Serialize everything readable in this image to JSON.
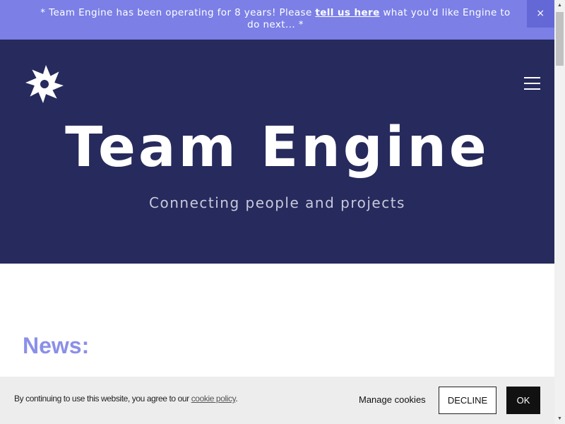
{
  "banner": {
    "text_before": "* Team Engine has been operating for 8 years! Please ",
    "link_text": "tell us here",
    "text_after": " what you'd like Engine to do next... *",
    "close_label": "×"
  },
  "header": {
    "logo_icon": "pinwheel-logo-icon",
    "menu_icon": "hamburger-menu-icon"
  },
  "hero": {
    "title": "Team Engine",
    "subtitle": "Connecting people and projects"
  },
  "main": {
    "news_heading": "News:"
  },
  "cookie_bar": {
    "text_before": "By continuing to use this website, you agree to our ",
    "link_text": "cookie policy",
    "text_after": ".",
    "manage_label": "Manage cookies",
    "decline_label": "DECLINE",
    "ok_label": "OK"
  },
  "scrollbar": {
    "up_icon": "▲",
    "down_icon": "▼"
  },
  "colors": {
    "banner_bg": "#7b7fe6",
    "hero_bg": "#262a5c",
    "accent": "#8b8fe8",
    "cookie_bg": "#ededed"
  }
}
